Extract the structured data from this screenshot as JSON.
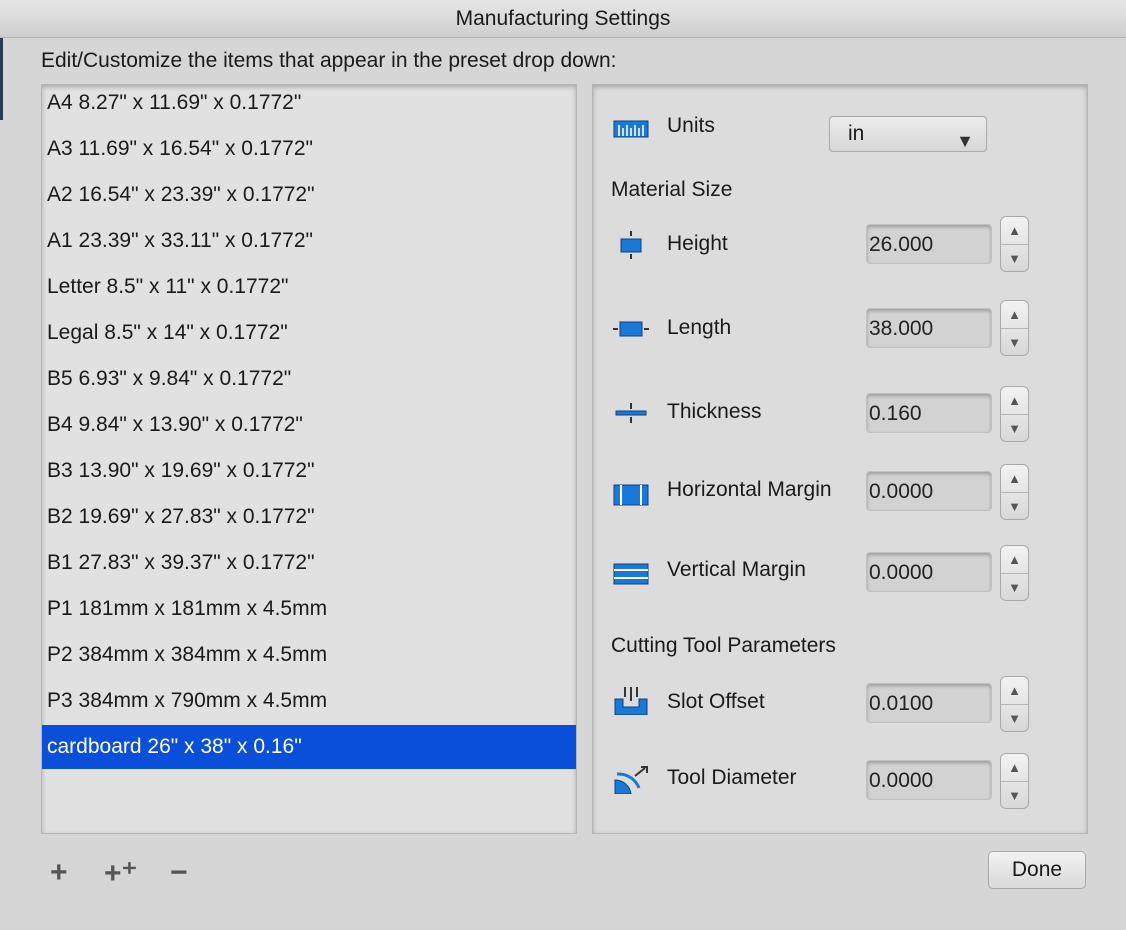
{
  "window": {
    "title": "Manufacturing Settings"
  },
  "instruction": "Edit/Customize the items that appear in the preset drop down:",
  "presets": [
    "A4 8.27\" x 11.69\" x 0.1772\"",
    "A3 11.69\" x 16.54\" x 0.1772\"",
    "A2 16.54\" x 23.39\" x 0.1772\"",
    "A1 23.39\" x 33.11\" x 0.1772\"",
    "Letter 8.5\" x 11\" x 0.1772\"",
    "Legal 8.5\" x 14\" x 0.1772\"",
    "B5 6.93\" x 9.84\" x 0.1772\"",
    "B4 9.84\" x 13.90\" x 0.1772\"",
    "B3 13.90\" x 19.69\" x 0.1772\"",
    "B2 19.69\" x 27.83\" x 0.1772\"",
    "B1 27.83\" x 39.37\" x 0.1772\"",
    "P1 181mm x 181mm x 4.5mm",
    "P2 384mm x 384mm x 4.5mm",
    "P3 384mm x 790mm x 4.5mm",
    "cardboard 26\" x 38\" x 0.16\""
  ],
  "selected_preset_index": 14,
  "units": {
    "label": "Units",
    "value": "in",
    "icon": "ruler-icon"
  },
  "material_size": {
    "heading": "Material Size",
    "height": {
      "label": "Height",
      "value": "26.000",
      "icon": "height-icon"
    },
    "length": {
      "label": "Length",
      "value": "38.000",
      "icon": "length-icon"
    },
    "thickness": {
      "label": "Thickness",
      "value": "0.160",
      "icon": "thickness-icon"
    },
    "horizontal_margin": {
      "label": "Horizontal Margin",
      "value": "0.0000",
      "icon": "horizontal-margin-icon"
    },
    "vertical_margin": {
      "label": "Vertical Margin",
      "value": "0.0000",
      "icon": "vertical-margin-icon"
    }
  },
  "cutting_tool": {
    "heading": "Cutting Tool Parameters",
    "slot_offset": {
      "label": "Slot  Offset",
      "value": "0.0100",
      "icon": "slot-offset-icon"
    },
    "tool_diameter": {
      "label": "Tool Diameter",
      "value": "0.0000",
      "icon": "tool-diameter-icon"
    }
  },
  "toolbar": {
    "add": "+",
    "duplicate": "+⁺",
    "remove": "−"
  },
  "done_label": "Done",
  "colors": {
    "selection": "#0a4fd9",
    "icon_blue": "#1a78d8"
  }
}
